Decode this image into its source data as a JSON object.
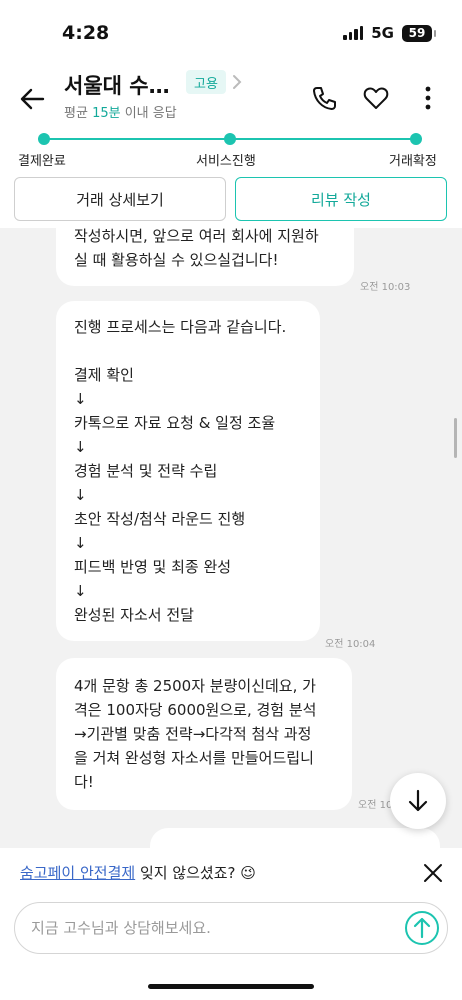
{
  "status_bar": {
    "time": "4:28",
    "network": "5G",
    "battery": "59"
  },
  "header": {
    "title": "서울대 수…",
    "badge": "고용",
    "subtitle_prefix": "평균 ",
    "subtitle_highlight": "15분",
    "subtitle_suffix": " 이내 응답",
    "icons": {
      "back": "back-arrow-icon",
      "phone": "phone-icon",
      "favorite": "heart-icon",
      "more": "more-vertical-icon"
    }
  },
  "progress": {
    "steps": [
      {
        "label": "결제완료"
      },
      {
        "label": "서비스진행"
      },
      {
        "label": "거래확정"
      }
    ],
    "accent_color": "#1cc4b0"
  },
  "actions": {
    "detail_label": "거래 상세보기",
    "review_label": "리뷰 작성"
  },
  "chat": {
    "messages": [
      {
        "text": "작성하시면, 앞으로 여러 회사에 지원하\n실 때 활용하실 수 있으실겁니다!",
        "time": "오전 10:03"
      },
      {
        "text": "진행 프로세스는 다음과 같습니다.\n\n결제 확인\n↓\n카톡으로 자료 요청 & 일정 조율\n↓\n경험 분석 및 전략 수립\n↓\n초안 작성/첨삭 라운드 진행\n↓\n피드백 반영 및 최종 완성\n↓\n완성된 자소서 전달",
        "time": "오전 10:04"
      },
      {
        "text": "4개 문항 총 2500자 분량이신데요, 가\n격은 100자당 6000원으로, 경험 분석\n→기관별 맞춤 전략→다각적 첨삭 과정\n을 거쳐 완성형 자소서를 만들어드립니\n다!",
        "time": "오전 10"
      }
    ]
  },
  "notice": {
    "link": "숨고페이 안전결제",
    "text": " 잊지 않으셨죠? ",
    "emoji": "😉"
  },
  "composer": {
    "placeholder": "지금 고수님과 상담해보세요."
  }
}
